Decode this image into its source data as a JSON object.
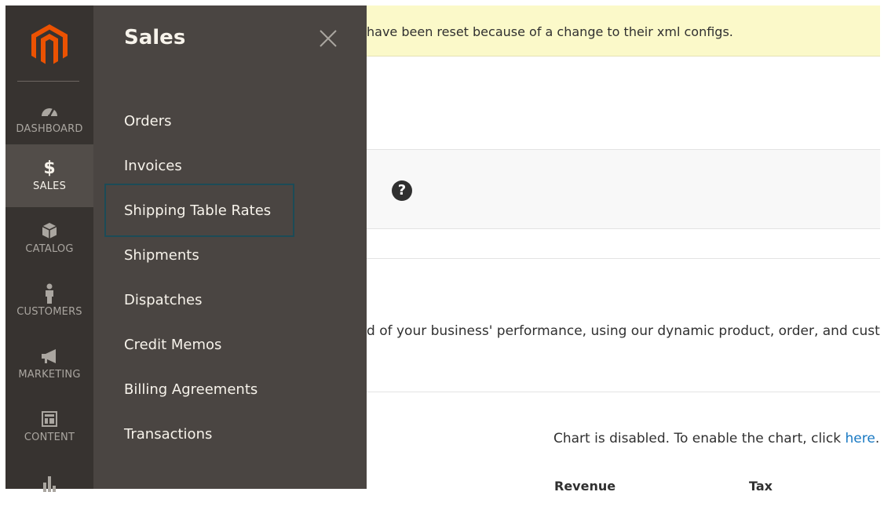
{
  "notice": {
    "text": "have been reset because of a change to their xml configs."
  },
  "nav": {
    "items": [
      {
        "key": "dashboard",
        "label": "DASHBOARD",
        "icon": "dashboard-icon"
      },
      {
        "key": "sales",
        "label": "SALES",
        "icon": "dollar-icon",
        "active": true
      },
      {
        "key": "catalog",
        "label": "CATALOG",
        "icon": "box-icon"
      },
      {
        "key": "customers",
        "label": "CUSTOMERS",
        "icon": "person-icon"
      },
      {
        "key": "marketing",
        "label": "MARKETING",
        "icon": "megaphone-icon"
      },
      {
        "key": "content",
        "label": "CONTENT",
        "icon": "layout-icon"
      },
      {
        "key": "reports",
        "label": "",
        "icon": "bar-chart-icon"
      }
    ]
  },
  "submenu": {
    "title": "Sales",
    "items": [
      "Orders",
      "Invoices",
      "Shipping Table Rates",
      "Shipments",
      "Dispatches",
      "Credit Memos",
      "Billing Agreements",
      "Transactions"
    ],
    "focused_index": 2
  },
  "main": {
    "business_text": "d of your business' performance, using our dynamic product, order, and custo",
    "chart_disabled_text": "Chart is disabled. To enable the chart, click ",
    "chart_link": "here",
    "chart_after": ".",
    "columns": [
      "Revenue",
      "Tax"
    ]
  },
  "colors": {
    "rail_bg": "#373330",
    "panel_bg": "#4a4542",
    "active_bg": "#524d49",
    "brand_orange": "#eb5202",
    "notice_bg": "#fbf9c9",
    "link": "#1979c3",
    "focus_border": "#1c4b57"
  }
}
